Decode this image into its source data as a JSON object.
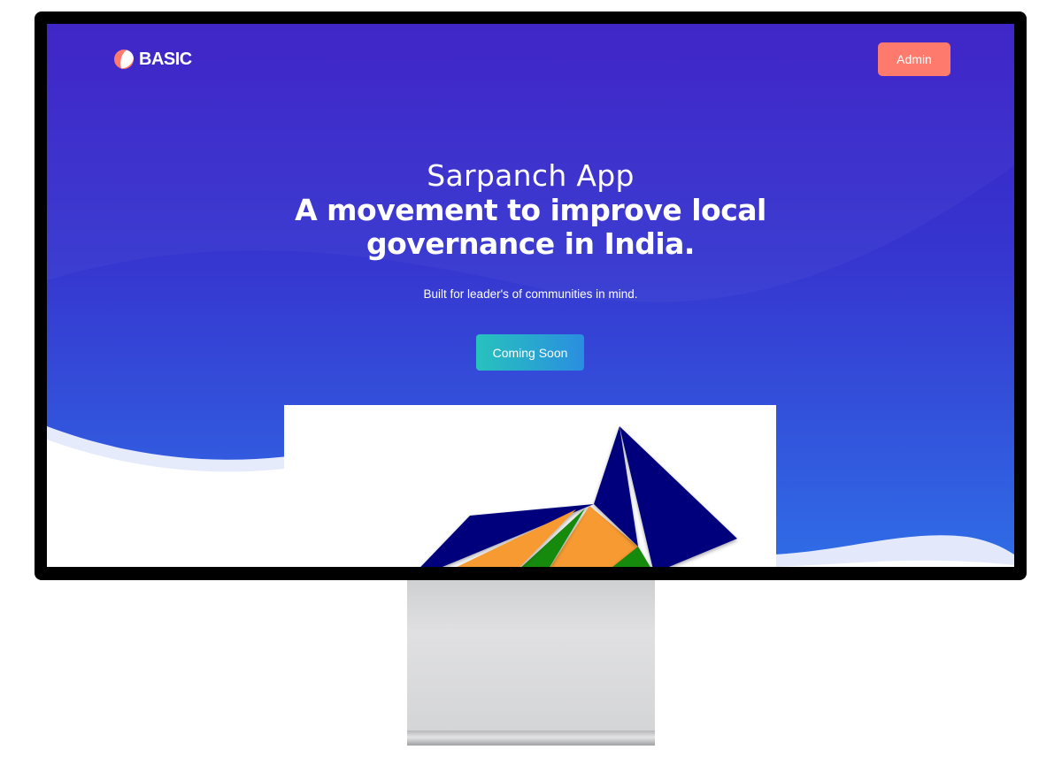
{
  "header": {
    "logo_text": "BASIC",
    "admin_label": "Admin"
  },
  "hero": {
    "subtitle": "Sarpanch App",
    "title": "A movement to improve local governance in India.",
    "description": "Built for leader's of communities in mind.",
    "cta_label": "Coming Soon"
  },
  "icons": {
    "logo": "leaf-logo-icon",
    "preview": "tricolor-origami-bird-graphic"
  },
  "colors": {
    "gradient_top": "#3a1fc6",
    "gradient_bottom": "#2f6de6",
    "admin_button": "#fd7a6c",
    "cta_start": "#27c2bd",
    "cta_end": "#2a8ee0",
    "saffron": "#f79a33",
    "green": "#128a09",
    "navy": "#00007d"
  }
}
